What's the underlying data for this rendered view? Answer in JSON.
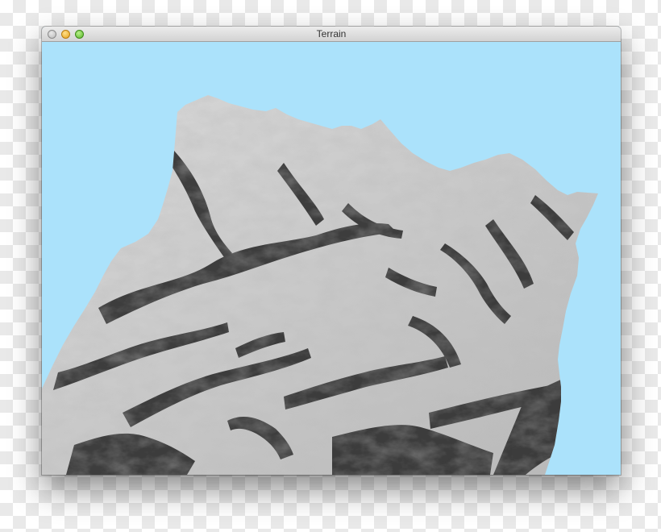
{
  "window": {
    "title": "Terrain",
    "sky_color": "#abe2fb"
  },
  "traffic_lights": [
    "close",
    "minimize",
    "maximize"
  ],
  "terrain": {
    "description_icon": "terrain-mesh",
    "base_color": "#cfcfcf",
    "shadow_color": "#2e2e2e"
  }
}
